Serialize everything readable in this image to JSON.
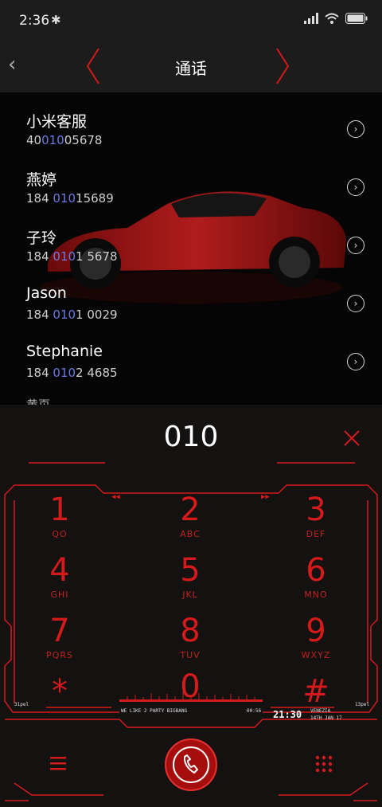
{
  "status_bar": {
    "time": "2:36"
  },
  "header": {
    "title": "通话"
  },
  "contacts": [
    {
      "name": "小米客服",
      "num_pre": "40",
      "num_hl": "010",
      "num_post": "05678"
    },
    {
      "name": "燕婷",
      "num_pre": "184 ",
      "num_hl": "010",
      "num_post": "15689"
    },
    {
      "name": "子玲",
      "num_pre": "184 ",
      "num_hl": "010",
      "num_post": "1 5678"
    },
    {
      "name": "Jason",
      "num_pre": "184 ",
      "num_hl": "010",
      "num_post": "1 0029"
    },
    {
      "name": "Stephanie",
      "num_pre": "184 ",
      "num_hl": "010",
      "num_post": "2 4685"
    },
    {
      "name": "黄页"
    }
  ],
  "dialer": {
    "entered": "010",
    "keys": [
      {
        "digit": "1",
        "letters": "QO"
      },
      {
        "digit": "2",
        "letters": "ABC"
      },
      {
        "digit": "3",
        "letters": "DEF"
      },
      {
        "digit": "4",
        "letters": "GHI"
      },
      {
        "digit": "5",
        "letters": "JKL"
      },
      {
        "digit": "6",
        "letters": "MNO"
      },
      {
        "digit": "7",
        "letters": "PQRS"
      },
      {
        "digit": "8",
        "letters": "TUV"
      },
      {
        "digit": "9",
        "letters": "WXYZ"
      },
      {
        "digit": "*",
        "letters": ""
      },
      {
        "digit": "0",
        "letters": ""
      },
      {
        "digit": "#",
        "letters": ""
      }
    ],
    "deco": {
      "slogan": "WE LIKE 2 PARTY BIGBANG",
      "duration": "00:56",
      "clock": "21:30",
      "city": "VENEZIA",
      "date": "14TH JAN 17",
      "left_tag": "31pel",
      "right_tag": "13pel"
    }
  },
  "colors": {
    "accent": "#d41a1a",
    "highlight": "#6b78e0"
  }
}
